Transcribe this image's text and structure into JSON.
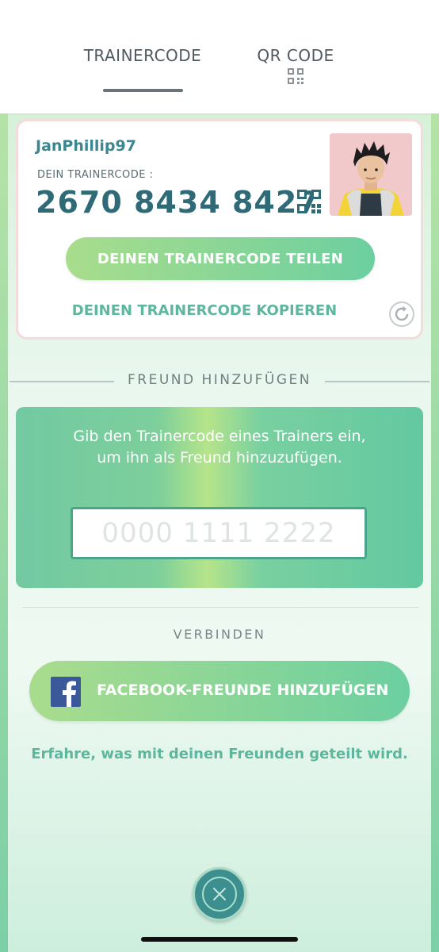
{
  "tabs": {
    "trainercode_label": "TRAINERCODE",
    "qrcode_label": "QR CODE"
  },
  "trainer": {
    "username": "JanPhillip97",
    "code_label": "DEIN TRAINERCODE :",
    "code": "2670 8434 8427",
    "share_label": "DEINEN TRAINERCODE TEILEN",
    "copy_label": "DEINEN TRAINERCODE KOPIEREN"
  },
  "add_friend": {
    "heading": "FREUND HINZUFÜGEN",
    "instructions": "Gib den Trainercode eines Trainers ein, um ihn als Freund hinzuzufügen.",
    "input_placeholder": "0000 1111 2222",
    "input_value": ""
  },
  "connect": {
    "heading": "VERBINDEN",
    "facebook_label": "FACEBOOK-FREUNDE HINZUFÜGEN",
    "info_link": "Erfahre, was mit deinen Freunden geteilt wird."
  },
  "icons": {
    "qr": "qr-code-icon",
    "refresh": "refresh-icon",
    "facebook": "facebook-icon",
    "close": "close-icon"
  },
  "colors": {
    "accent_teal": "#3c8690",
    "button_gradient_start": "#a9dd8c",
    "button_gradient_end": "#6ccfa0",
    "link_green": "#5eb69c",
    "facebook_blue": "#3b5998"
  }
}
